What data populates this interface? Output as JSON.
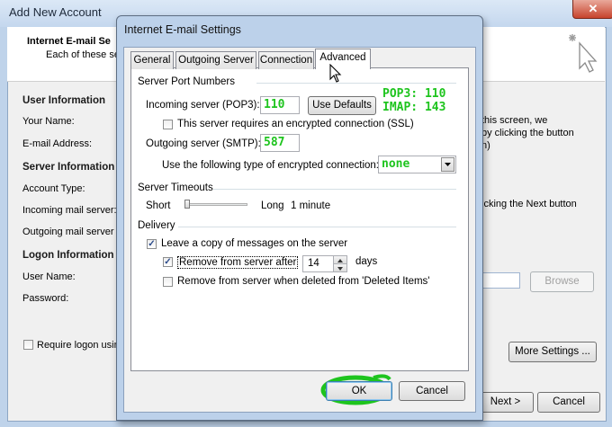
{
  "background_window": {
    "title": "Add New Account",
    "close_glyph": "✕",
    "header_title": "Internet E-mail Se",
    "header_subtitle": "Each of these se",
    "user_info_heading": "User Information",
    "your_name_label": "Your Name:",
    "email_label": "E-mail Address:",
    "server_info_heading": "Server Information",
    "account_type_label": "Account Type:",
    "incoming_label": "Incoming mail server:",
    "outgoing_label": "Outgoing mail server (",
    "logon_heading": "Logon Information",
    "username_label": "User Name:",
    "password_label": "Password:",
    "require_logon_label": "Require logon usin",
    "right_text_1": "this screen, we",
    "right_text_2": "by clicking the button",
    "right_text_3": "n)",
    "right_text_4": "icking the Next button",
    "browse_label": "Browse",
    "more_settings_label": "More Settings ...",
    "next_label": "Next >",
    "cancel_label": "Cancel"
  },
  "dialog": {
    "title": "Internet E-mail Settings",
    "tabs": [
      {
        "label": "General",
        "active": false
      },
      {
        "label": "Outgoing Server",
        "active": false
      },
      {
        "label": "Connection",
        "active": false
      },
      {
        "label": "Advanced",
        "active": true
      }
    ],
    "server_port_numbers": {
      "heading": "Server Port Numbers",
      "incoming_label": "Incoming server (POP3):",
      "incoming_value": "110",
      "use_defaults_label": "Use Defaults",
      "ssl_checkbox_label": "This server requires an encrypted connection (SSL)",
      "ssl_checked": false,
      "outgoing_label": "Outgoing server (SMTP):",
      "outgoing_value": "587",
      "encryption_label": "Use the following type of encrypted connection:",
      "encryption_value": "none"
    },
    "annotations": {
      "pop3": "POP3: 110",
      "imap": "IMAP: 143"
    },
    "server_timeouts": {
      "heading": "Server Timeouts",
      "short_label": "Short",
      "long_label": "Long",
      "value_text": "1 minute",
      "slider_fraction": 0.0
    },
    "delivery": {
      "heading": "Delivery",
      "leave_copy_label": "Leave a copy of messages on the server",
      "leave_copy_checked": true,
      "remove_after_label": "Remove from server after",
      "remove_after_checked": true,
      "days_value": "14",
      "days_label": "days",
      "remove_deleted_label": "Remove from server when deleted from 'Deleted Items'",
      "remove_deleted_checked": false
    },
    "ok_label": "OK",
    "cancel_label": "Cancel"
  },
  "colors": {
    "annotation": "#1ec41e",
    "title_bar": "#bcd1ea"
  }
}
